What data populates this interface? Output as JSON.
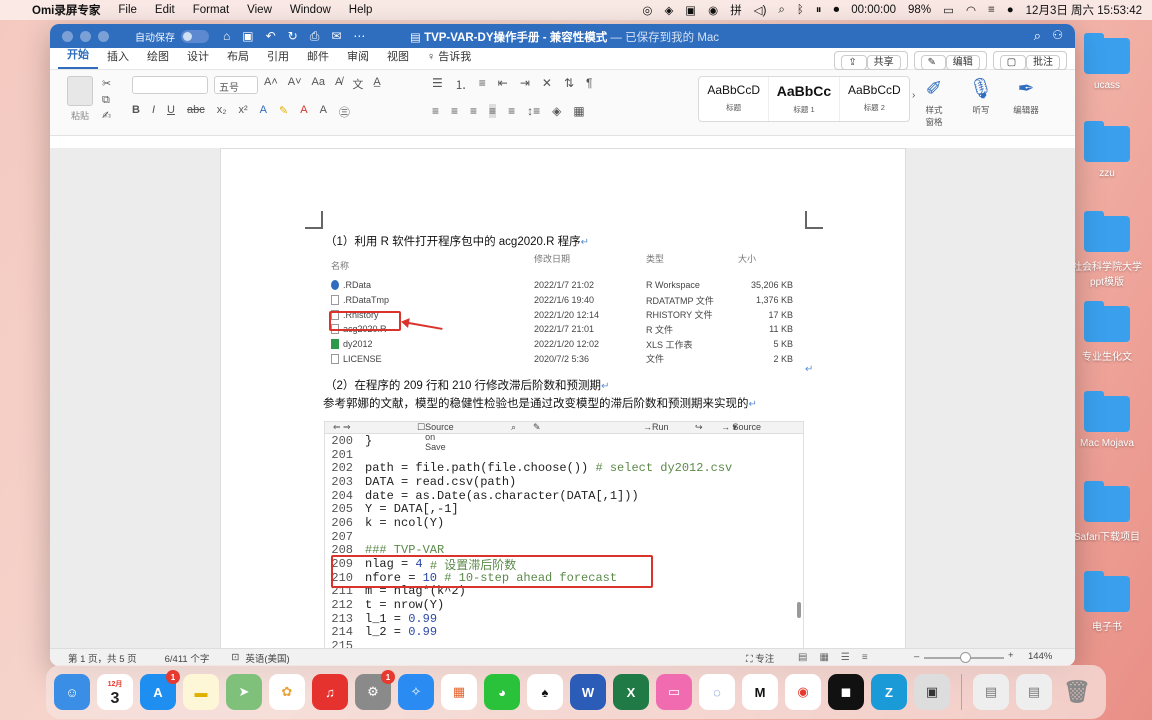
{
  "menubar": {
    "app": "Omi录屏专家",
    "items": [
      "File",
      "Edit",
      "Format",
      "View",
      "Window",
      "Help"
    ],
    "timer": "00:00:00",
    "battery": "98%",
    "datetime": "12月3日 周六  15:53:42"
  },
  "window": {
    "autosave": "自动保存",
    "title": "TVP-VAR-DY操作手册",
    "mode": " - 兼容性模式",
    "saved": " — 已保存到我的 Mac"
  },
  "tabs": [
    "开始",
    "插入",
    "绘图",
    "设计",
    "布局",
    "引用",
    "邮件",
    "审阅",
    "视图",
    "♀ 告诉我"
  ],
  "tab_actions": {
    "share": "共享",
    "edit": "编辑",
    "comment": "批注"
  },
  "ribbon": {
    "paste": "粘贴",
    "font_size": "五号",
    "styles": [
      {
        "sample": "AaBbCcD",
        "name": "标题"
      },
      {
        "sample": "AaBbCc",
        "name": "标题 1"
      },
      {
        "sample": "AaBbCcD",
        "name": "标题 2"
      }
    ],
    "style_pane": "样式\n窗格",
    "dictate": "听写",
    "editor": "编辑器"
  },
  "doc": {
    "para1": "（1）利用 R 软件打开程序包中的 acg2020.R 程序",
    "file_headers": [
      "名称",
      "修改日期",
      "类型",
      "大小"
    ],
    "files": [
      {
        "name": ".RData",
        "date": "2022/1/7 21:02",
        "type": "R Workspace",
        "size": "35,206 KB",
        "icon": "r"
      },
      {
        "name": ".RDataTmp",
        "date": "2022/1/6 19:40",
        "type": "RDATATMP 文件",
        "size": "1,376 KB",
        "icon": "file"
      },
      {
        "name": ".Rhistory",
        "date": "2022/1/20 12:14",
        "type": "RHISTORY 文件",
        "size": "17 KB",
        "icon": "file"
      },
      {
        "name": "acg2020.R",
        "date": "2022/1/7 21:01",
        "type": "R 文件",
        "size": "11 KB",
        "icon": "file"
      },
      {
        "name": "dy2012",
        "date": "2022/1/20 12:02",
        "type": "XLS 工作表",
        "size": "5 KB",
        "icon": "xls"
      },
      {
        "name": "LICENSE",
        "date": "2020/7/2 5:36",
        "type": "文件",
        "size": "2 KB",
        "icon": "file"
      }
    ],
    "para2": "（2）在程序的 209 行和 210 行修改滞后阶数和预测期",
    "para3": "参考郭娜的文献，模型的稳健性检验也是通过改变模型的滞后阶数和预测期来实现的",
    "editor_toolbar": {
      "source_on_save": "Source on Save",
      "run": "Run",
      "source": "Source"
    },
    "code": [
      {
        "n": "200",
        "parts": [
          {
            "t": "}",
            "c": "cd"
          }
        ]
      },
      {
        "n": "201",
        "parts": []
      },
      {
        "n": "202",
        "parts": [
          {
            "t": "path = file.path(file.choose()) ",
            "c": "cd"
          },
          {
            "t": "# select dy2012.csv",
            "c": "cm"
          }
        ]
      },
      {
        "n": "203",
        "parts": [
          {
            "t": "DATA = read.csv(path)",
            "c": "cd"
          }
        ]
      },
      {
        "n": "204",
        "parts": [
          {
            "t": "date = as.Date(as.character(DATA[,1]))",
            "c": "cd"
          }
        ]
      },
      {
        "n": "205",
        "parts": [
          {
            "t": "Y = DATA[,-1]",
            "c": "cd"
          }
        ]
      },
      {
        "n": "206",
        "parts": [
          {
            "t": "k = ncol(Y)",
            "c": "cd"
          }
        ]
      },
      {
        "n": "207",
        "parts": []
      },
      {
        "n": "208",
        "parts": [
          {
            "t": "### TVP-VAR",
            "c": "cm"
          }
        ]
      },
      {
        "n": "209",
        "parts": [
          {
            "t": "nlag = ",
            "c": "cd"
          },
          {
            "t": "4",
            "c": "nm"
          },
          {
            "t": " # 设置滞后阶数",
            "c": "cm"
          }
        ]
      },
      {
        "n": "210",
        "parts": [
          {
            "t": "nfore = ",
            "c": "cd"
          },
          {
            "t": "10",
            "c": "nm"
          },
          {
            "t": " # 10-step ahead forecast",
            "c": "cm"
          }
        ]
      },
      {
        "n": "211",
        "parts": [
          {
            "t": "m = nlag*(k^2)",
            "c": "cd"
          }
        ]
      },
      {
        "n": "212",
        "parts": [
          {
            "t": "t = nrow(Y)",
            "c": "cd"
          }
        ]
      },
      {
        "n": "213",
        "parts": [
          {
            "t": "l_1 = ",
            "c": "cd"
          },
          {
            "t": "0.99",
            "c": "nm"
          }
        ]
      },
      {
        "n": "214",
        "parts": [
          {
            "t": "l_2 = ",
            "c": "cd"
          },
          {
            "t": "0.99",
            "c": "nm"
          }
        ]
      },
      {
        "n": "215",
        "parts": []
      }
    ]
  },
  "status": {
    "page": "第 1 页，共 5 页",
    "words": "6/411 个字",
    "lang": "英语(美国)",
    "focus": "专注",
    "zoom": "144%"
  },
  "desktop": [
    "ucass",
    "zzu",
    "社会科学院大学\nppt模版",
    "专业生化文",
    "Mac Mojava",
    "Safari下载项目",
    "电子书"
  ],
  "dock": {
    "calendar_month": "12月",
    "calendar_day": "3",
    "badges": {
      "appstore": "1",
      "settings": "1"
    }
  },
  "colors": {
    "accent": "#2f6dbf",
    "highlight": "#d9332b"
  }
}
